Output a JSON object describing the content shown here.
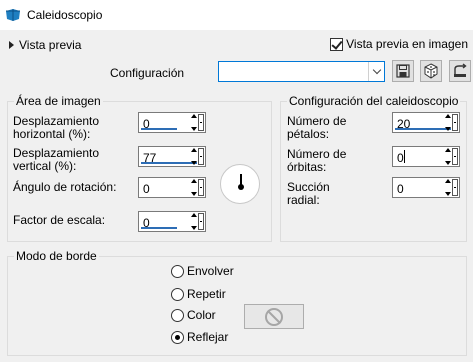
{
  "window": {
    "title": "Caleidoscopio",
    "icon": "app-icon"
  },
  "toolbar": {
    "preview_toggle": "Vista previa",
    "preview_in_image": "Vista previa en imagen",
    "preview_in_image_checked": true,
    "config_label": "Configuración",
    "config_value": "",
    "buttons": [
      "save-preset-icon",
      "randomize-dice-icon",
      "reset-icon"
    ]
  },
  "image_area": {
    "title": "Área de imagen",
    "h_offset": {
      "label_1": "Desplazamiento",
      "label_2": "horizontal (%):",
      "value": "0"
    },
    "v_offset": {
      "label_1": "Desplazamiento",
      "label_2": "vertical (%):",
      "value": "77"
    },
    "rotation": {
      "label": "Ángulo de rotación:",
      "value": "0"
    },
    "scale": {
      "label": "Factor de escala:",
      "value": "0"
    }
  },
  "kaleidoscope": {
    "title": "Configuración del caleidoscopio",
    "petals": {
      "label_1": "Número de",
      "label_2": "pétalos:",
      "value": "20"
    },
    "orbits": {
      "label_1": "Número de",
      "label_2": "órbitas:",
      "value": "0"
    },
    "suction": {
      "label_1": "Succión",
      "label_2": "radial:",
      "value": "0"
    }
  },
  "edge_mode": {
    "title": "Modo de borde",
    "options": [
      "Envolver",
      "Repetir",
      "Color",
      "Reflejar"
    ],
    "selected": "Reflejar"
  },
  "colors": {
    "accent": "#0078d7",
    "bar": "#2d6db5"
  }
}
